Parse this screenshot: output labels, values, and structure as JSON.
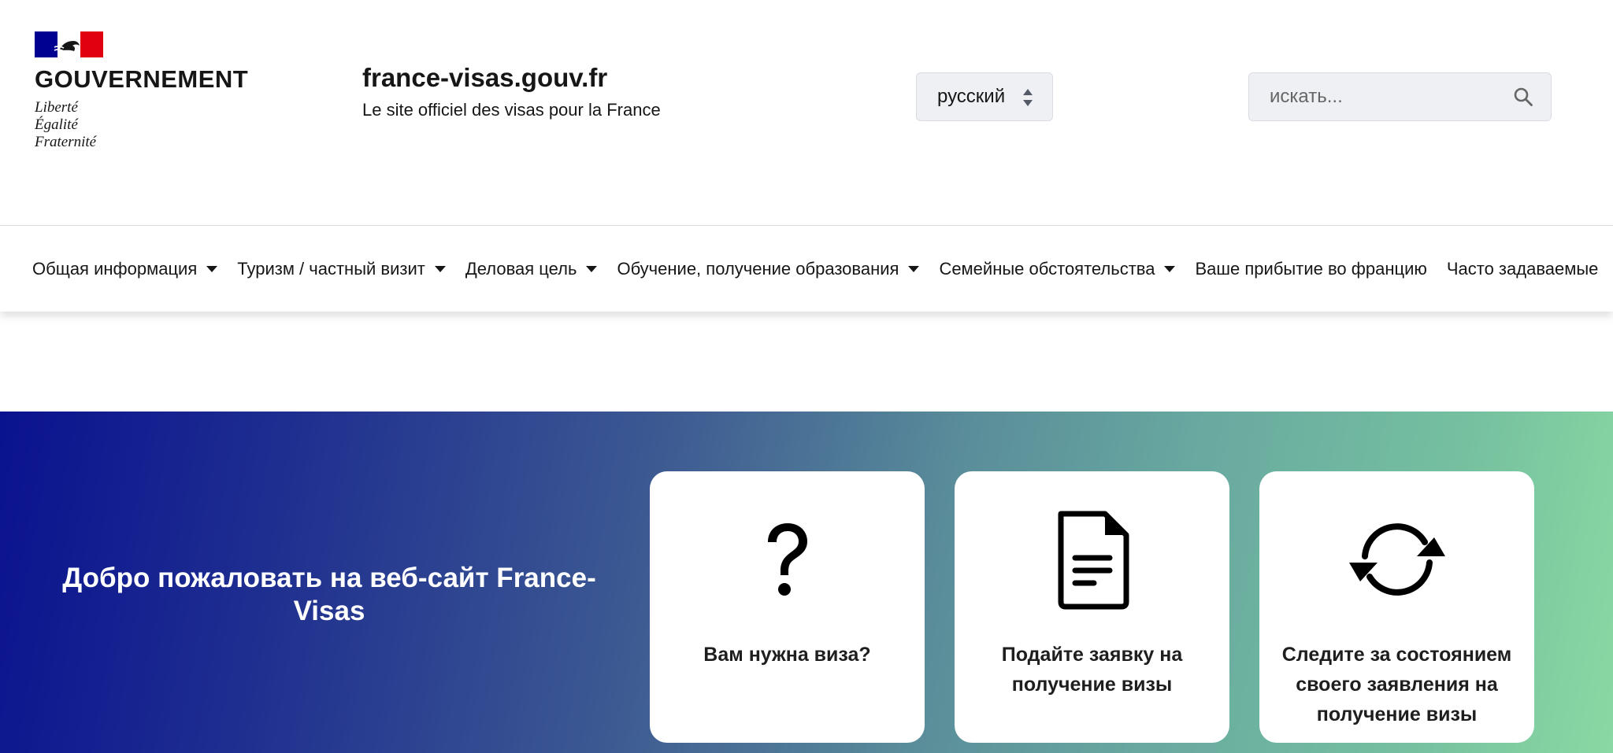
{
  "header": {
    "gov_name": "GOUVERNEMENT",
    "motto": [
      "Liberté",
      "Égalité",
      "Fraternité"
    ],
    "site_title": "france-visas.gouv.fr",
    "site_tagline": "Le site officiel des visas pour la France",
    "language_selected": "русский",
    "search_placeholder": "искать..."
  },
  "nav": {
    "items": [
      {
        "label": "Общая информация",
        "dropdown": true
      },
      {
        "label": "Туризм / частный визит",
        "dropdown": true
      },
      {
        "label": "Деловая цель",
        "dropdown": true
      },
      {
        "label": "Обучение, получение образования",
        "dropdown": true
      },
      {
        "label": "Семейные обстоятельства",
        "dropdown": true
      },
      {
        "label": "Ваше прибытие во францию",
        "dropdown": false
      },
      {
        "label": "Часто задаваемые",
        "dropdown": false
      }
    ]
  },
  "hero": {
    "welcome": "Добро пожаловать на веб-сайт France-Visas",
    "cards": [
      {
        "label": "Вам нужна виза?",
        "icon": "question-mark-icon"
      },
      {
        "label": "Подайте заявку на получение визы",
        "icon": "document-icon"
      },
      {
        "label": "Следите за состоянием своего заявления на получение визы",
        "icon": "refresh-icon"
      }
    ]
  },
  "colors": {
    "flag_blue": "#000091",
    "flag_red": "#e1000f",
    "gradient_start": "#0a128f",
    "gradient_end": "#8ad9a2"
  }
}
